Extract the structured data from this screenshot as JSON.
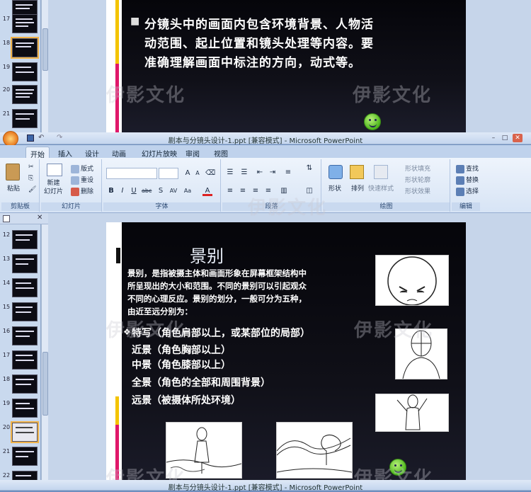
{
  "window": {
    "title": "剧本与分镜头设计-1.ppt [兼容模式] - Microsoft PowerPoint",
    "quick_access": [
      "save",
      "undo",
      "redo"
    ],
    "controls": [
      "–",
      "□",
      "✕"
    ]
  },
  "tabs": [
    "开始",
    "插入",
    "设计",
    "动画",
    "幻灯片放映",
    "审阅",
    "视图"
  ],
  "ribbon": {
    "clipboard": {
      "label": "剪贴板",
      "paste": "粘贴"
    },
    "slides": {
      "label": "幻灯片",
      "new_slide": "新建\n幻灯片",
      "layout": "版式",
      "reset": "重设",
      "delete": "删除"
    },
    "font": {
      "label": "字体"
    },
    "paragraph": {
      "label": "段落"
    },
    "drawing": {
      "label": "绘图",
      "shape": "形状",
      "arrange": "排列",
      "quick_style": "快速样式",
      "fill": "形状填充",
      "outline": "形状轮廓",
      "effect": "形状效果"
    },
    "editing": {
      "label": "编辑",
      "find": "查找",
      "replace": "替换",
      "select": "选择"
    }
  },
  "top_view": {
    "thumbnails": [
      "17",
      "18",
      "19",
      "20",
      "21"
    ],
    "selected": "18",
    "bullet_text": "分镜头中的画面内包含环境背景、人物活动范围、起止位置和镜头处理等内容。要准确理解画面中标注的方向，动式等。",
    "bullet_lines": [
      "分镜头中的画面内包含环境背景、人物活",
      "动范围、起止位置和镜头处理等内容。要",
      "准确理解画面中标注的方向，动式等。"
    ],
    "watermark_1": "伊影文化",
    "watermark_2": "伊影文化"
  },
  "bottom_view": {
    "thumbnails": [
      "12",
      "13",
      "14",
      "15",
      "16",
      "17",
      "18",
      "19",
      "20",
      "21",
      "22"
    ],
    "selected": "20",
    "slide": {
      "title": "景别",
      "intro_lines": [
        "景别，是指被摄主体和画面形象在屏幕框架结构中",
        "所呈现出的大小和范围。不同的景别可以引起观众",
        "不同的心理反应。景别的划分，一般可分为五种，",
        "由近至远分别为："
      ],
      "items": [
        "特写（角色肩部以上，或某部位的局部）",
        "近景（角色胸部以上）",
        "中景（角色膝部以上）",
        "全景（角色的全部和周围背景）",
        "远景（被摄体所处环境）"
      ]
    },
    "watermark": "伊影文化"
  },
  "bottom_titlebar": "剧本与分镜头设计-1.ppt [兼容模式] - Microsoft PowerPoint"
}
